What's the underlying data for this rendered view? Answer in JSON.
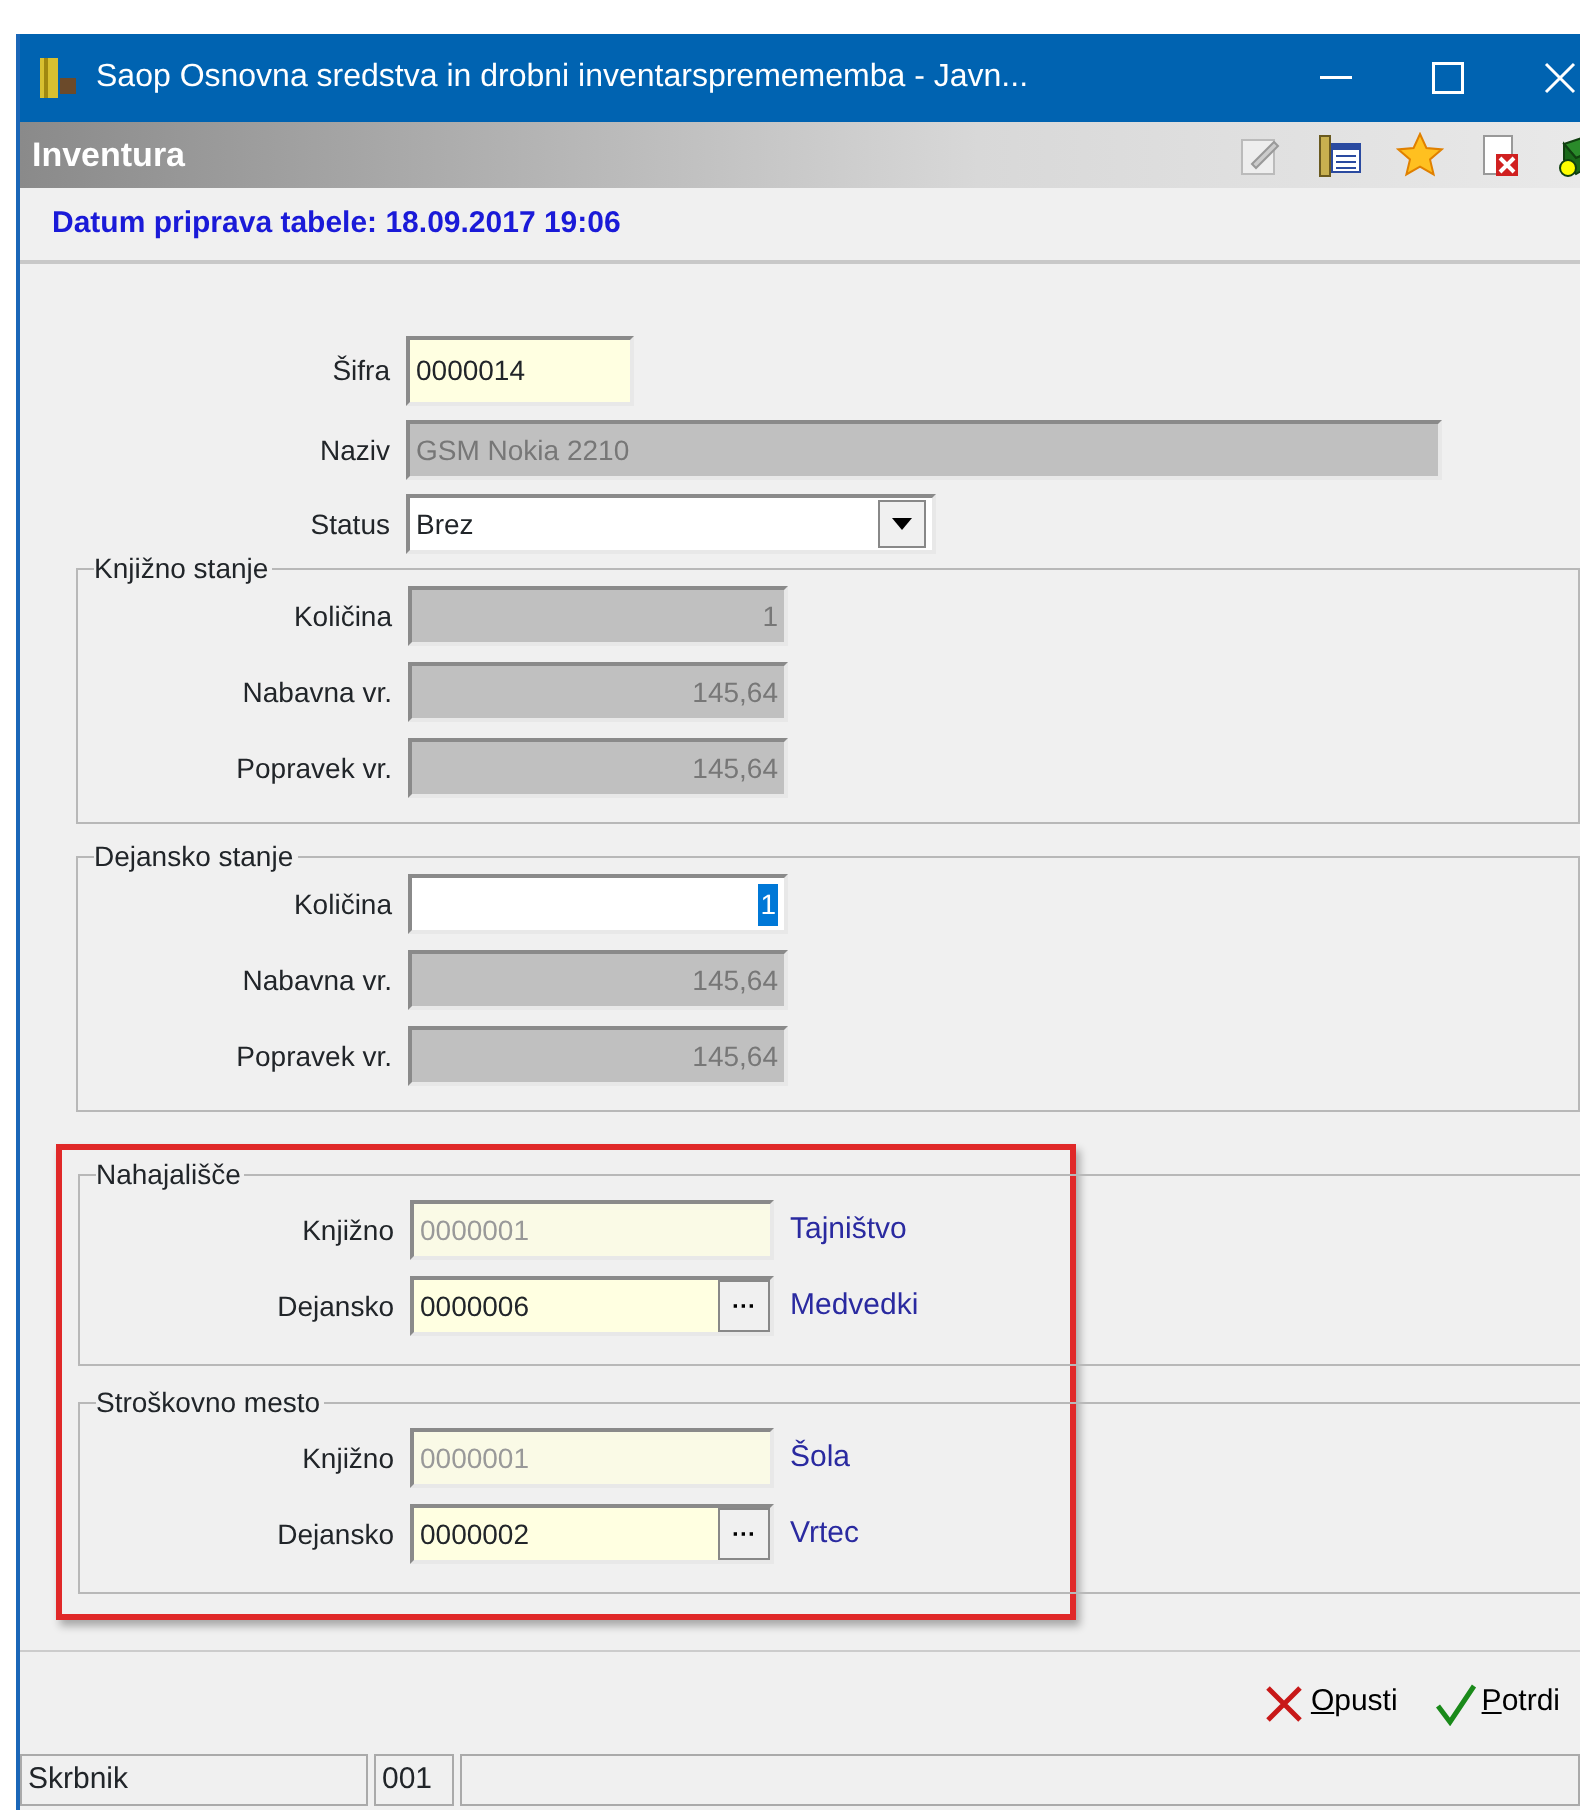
{
  "window": {
    "title": "Saop Osnovna sredstva in drobni inventarspremememba - Javn..."
  },
  "header": {
    "title": "Inventura"
  },
  "date_line": "Datum priprava tabele: 18.09.2017 19:06",
  "fields": [
    {
      "kind": "text",
      "label": "Šifra",
      "value": "0000014",
      "disabled": false
    },
    {
      "kind": "text",
      "label": "Naziv",
      "value": "GSM Nokia 2210",
      "disabled": true
    },
    {
      "kind": "select",
      "label": "Status",
      "value": "Brez",
      "disabled": false
    }
  ],
  "groups": [
    {
      "title": "Knjižno stanje",
      "kind": "amounts",
      "highlighted": false,
      "rows": [
        {
          "label": "Količina",
          "value": "1",
          "disabled": true,
          "selected": false
        },
        {
          "label": "Nabavna vr.",
          "value": "145,64",
          "disabled": true,
          "selected": false
        },
        {
          "label": "Popravek vr.",
          "value": "145,64",
          "disabled": true,
          "selected": false
        }
      ]
    },
    {
      "title": "Dejansko stanje",
      "kind": "amounts",
      "highlighted": false,
      "rows": [
        {
          "label": "Količina",
          "value": "1",
          "disabled": false,
          "selected": true
        },
        {
          "label": "Nabavna vr.",
          "value": "145,64",
          "disabled": true,
          "selected": false
        },
        {
          "label": "Popravek vr.",
          "value": "145,64",
          "disabled": true,
          "selected": false
        }
      ]
    },
    {
      "title": "Nahajališče",
      "kind": "codes",
      "highlighted": true,
      "rows": [
        {
          "label": "Knjižno",
          "value": "0000001",
          "disabled": true,
          "lookup": false,
          "description": "Tajništvo"
        },
        {
          "label": "Dejansko",
          "value": "0000006",
          "disabled": false,
          "lookup": true,
          "description": "Medvedki"
        }
      ]
    },
    {
      "title": "Stroškovno mesto",
      "kind": "codes",
      "highlighted": true,
      "rows": [
        {
          "label": "Knjižno",
          "value": "0000001",
          "disabled": true,
          "lookup": false,
          "description": "Šola"
        },
        {
          "label": "Dejansko",
          "value": "0000002",
          "disabled": false,
          "lookup": true,
          "description": "Vrtec"
        }
      ]
    }
  ],
  "lookup_button": "···",
  "buttons": [
    {
      "kind": "cancel",
      "label": "Opusti",
      "mnemonic": true
    },
    {
      "kind": "confirm",
      "label": "Potrdi",
      "mnemonic": true
    }
  ],
  "status_bar": [
    "Skrbnik",
    "001"
  ]
}
